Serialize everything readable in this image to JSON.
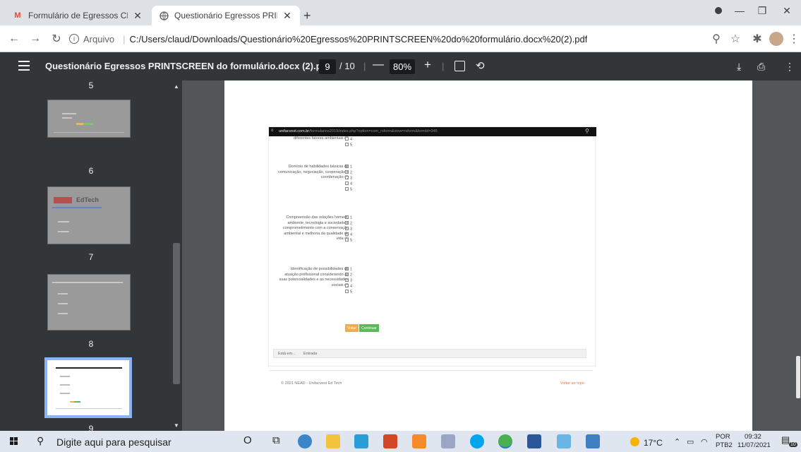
{
  "browser": {
    "tabs": [
      {
        "label": "Formulário de Egressos CPA unifa"
      },
      {
        "label": "Questionário Egressos PRINTSCR"
      }
    ],
    "new_tab": "+",
    "address": {
      "security_label": "Arquivo",
      "url": "C:/Users/claud/Downloads/Questionário%20Egressos%20PRINTSCREEN%20do%20formulário.docx%20(2).pdf"
    }
  },
  "pdf": {
    "title": "Questionário Egressos PRINTSCREEN do formulário.docx (2).pdf",
    "current_page": "9",
    "total_pages": "/ 10",
    "zoom": "80%",
    "thumbnail_numbers": [
      "5",
      "6",
      "7",
      "8",
      "9"
    ]
  },
  "document": {
    "site_url_host": "unifacvest.com.br",
    "site_url_rest": "/formularios2019/index.php?option=com_rsform&view=rsform&formId=345",
    "questions": [
      {
        "label": "diferentes fatores ambientais (*)",
        "options": [
          "4",
          "5"
        ]
      },
      {
        "label": "Domínio de habilidades básicas de comunicação, negociação, cooperação e coordenação (*)",
        "options": [
          "1",
          "2",
          "3",
          "4",
          "5"
        ]
      },
      {
        "label": "Compreensão das relações homem, ambiente, tecnologia e sociedade e comprometimento com a conservação ambiental e melhoria da qualidade de vida (*)",
        "options": [
          "1",
          "2",
          "3",
          "4",
          "5"
        ]
      },
      {
        "label": "Identificação de possibilidades de atuação profissional considerando as suas potencialidades e as necessidades sociais (*)",
        "options": [
          "1",
          "2",
          "3",
          "4",
          "5"
        ]
      }
    ],
    "back_button": "Voltar",
    "continue_button": "Continuar",
    "breadcrumb_prefix": "Está em...",
    "breadcrumb_current": "Entrada",
    "footer_copyright": "© 2021 NEAD - Unifacvest Ed Tech",
    "footer_top_link": "Voltar ao topo",
    "edtech_logo": "EdTech"
  },
  "taskbar": {
    "search_placeholder": "Digite aqui para pesquisar",
    "weather": "17°C",
    "lang_top": "POR",
    "lang_bottom": "PTB2",
    "time": "09:32",
    "date": "11/07/2021",
    "notifications": "10"
  },
  "colors": {
    "pdf_toolbar": "#323639",
    "viewer_bg": "#525659",
    "accent_green": "#5cb85c",
    "accent_orange": "#f0ad4e"
  }
}
